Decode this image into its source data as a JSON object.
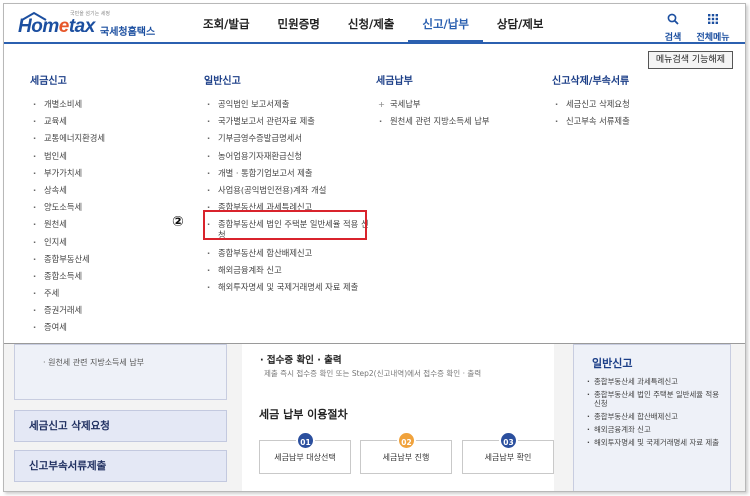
{
  "header": {
    "logo": {
      "tagline": "국민을 섬기는 세정",
      "home": "Hom",
      "e": "e",
      "tax": "tax",
      "korean": "국세청홈택스"
    },
    "nav": [
      {
        "label": "조회/발급",
        "active": false
      },
      {
        "label": "민원증명",
        "active": false
      },
      {
        "label": "신청/제출",
        "active": false
      },
      {
        "label": "신고/납부",
        "active": true
      },
      {
        "label": "상담/제보",
        "active": false
      }
    ],
    "search_label": "검색",
    "all_menu_label": "전체메뉴"
  },
  "mega_menu": {
    "shortcut_button": "메뉴검색 기능해제",
    "columns": [
      {
        "title": "세금신고",
        "items": [
          "개별소비세",
          "교육세",
          "교통에너지환경세",
          "법인세",
          "부가가치세",
          "상속세",
          "양도소득세",
          "원천세",
          "인지세",
          "종합부동산세",
          "종합소득세",
          "주세",
          "증권거래세",
          "증여세"
        ]
      },
      {
        "title": "일반신고",
        "items": [
          "공익법인 보고서제출",
          "국가별보고서 관련자료 제출",
          "기부금영수증발급명세서",
          "농어업용기자재환급신청",
          "개별 · 통합기업보고서 제출",
          "사업용(공익법인전용)계좌 개설",
          "종합부동산세 과세특례신고",
          "종합부동산세 법인 주택분 일반세율 적용 신청",
          "종합부동산세 합산배제신고",
          "해외금융계좌 신고",
          "해외투자명세 및 국제거래명세 자료 제출"
        ]
      },
      {
        "title": "세금납부",
        "items": [
          "국세납부",
          "원천세 관련 지방소득세 납부"
        ]
      },
      {
        "title": "신고삭제/부속서류",
        "items": [
          "세금신고 삭제요청",
          "신고부속 서류제출"
        ]
      }
    ],
    "marker": "②"
  },
  "background": {
    "left_panel_text": "· 원천세 관련 지방소득세 납부",
    "side_buttons": [
      "세금신고 삭제요청",
      "신고부속서류제출"
    ],
    "receipt_title": "· 접수증 확인 · 출력",
    "receipt_sub": "제출 즉시 접수증 확인 또는 Step2(신고내역)에서 접수증 확인 · 출력",
    "process_title": "세금 납부 이용절차",
    "steps": [
      {
        "num": "01",
        "label": "세금납부 대상선택"
      },
      {
        "num": "02",
        "label": "세금납부 진행"
      },
      {
        "num": "03",
        "label": "세금납부 확인"
      }
    ],
    "right_title": "일반신고",
    "right_items": [
      "종합부동산세 과세특례신고",
      "종합부동산세 법인 주택분 일반세율 적용 신청",
      "종합부동산세 합산배제신고",
      "해외금융계좌 신고",
      "해외투자명세 및 국제거래명세 자료 제출"
    ]
  }
}
